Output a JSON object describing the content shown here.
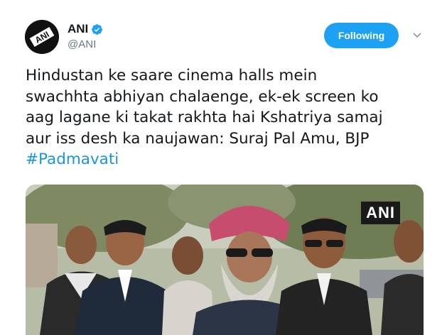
{
  "account": {
    "display_name": "ANI",
    "handle": "@ANI",
    "verified": true,
    "avatar_logo_text": "ANI"
  },
  "follow_button": {
    "label": "Following"
  },
  "menu": {
    "icon": "chevron-down-icon"
  },
  "tweet": {
    "lines": [
      "Hindustan ke saare cinema halls mein",
      "swachhta abhiyan chalaenge, ek-ek screen ko",
      "aag lagane ki takat rakhta hai Kshatriya samaj",
      "aur iss desh ka naujawan: Suraj Pal Amu, BJP"
    ],
    "hashtag": "#Padmavati"
  },
  "media": {
    "watermark": "ANI"
  },
  "colors": {
    "brand_blue": "#1da1f2",
    "link_blue": "#1b95e0",
    "text": "#14171a",
    "muted": "#657786"
  }
}
